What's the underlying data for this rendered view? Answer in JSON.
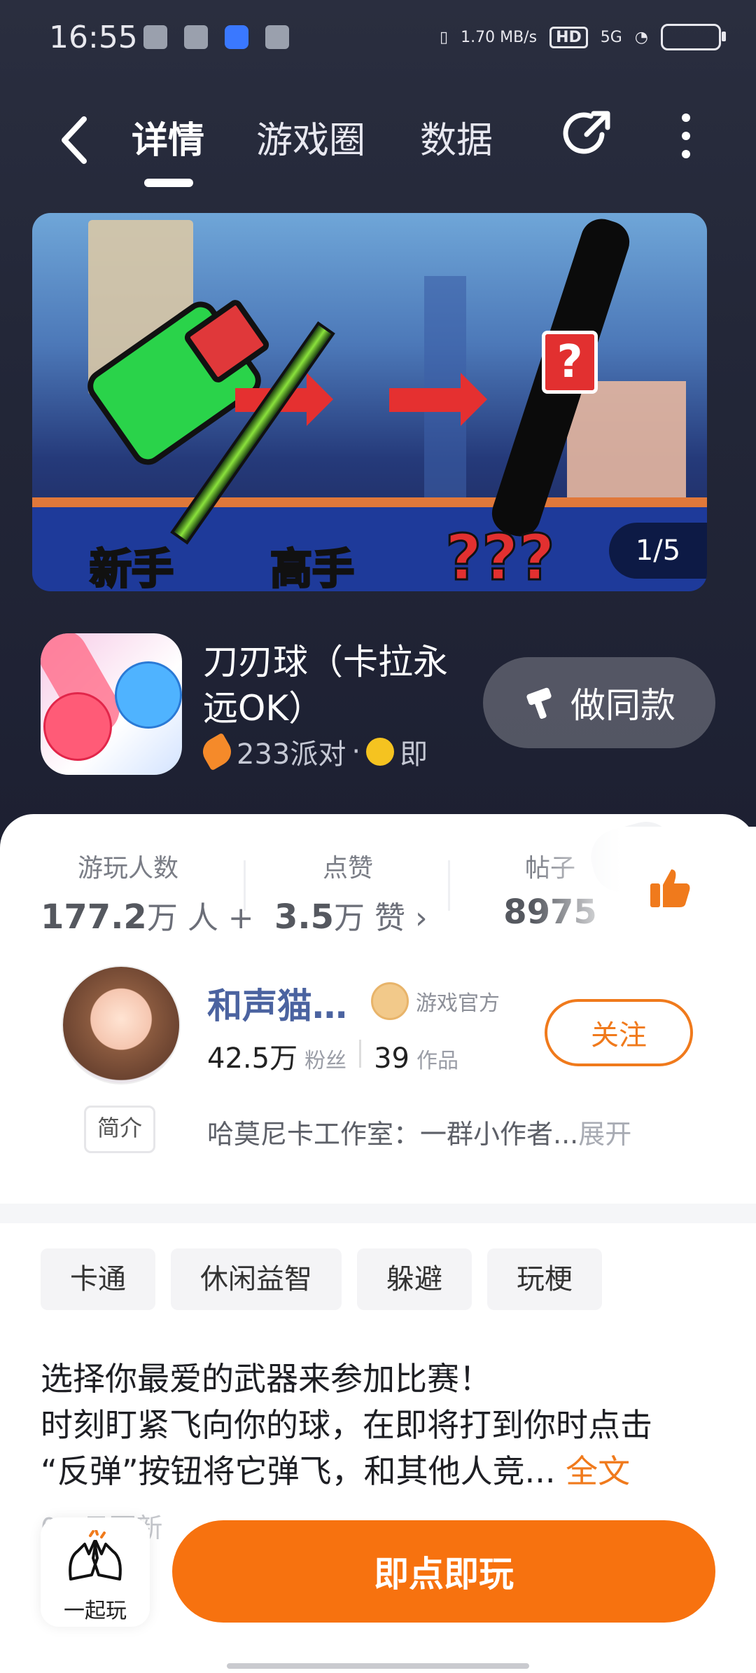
{
  "status_bar": {
    "time": "16:55",
    "net_speed": "1.70 MB/s",
    "hd": "HD",
    "signal": "5G"
  },
  "nav": {
    "tabs": [
      "详情",
      "游戏圈",
      "数据"
    ],
    "active_tab": "详情"
  },
  "banner": {
    "label_1": "新手",
    "label_2": "高手",
    "label_3": "???",
    "counter": "1/5"
  },
  "app": {
    "title": "刀刃球（卡拉永远OK）",
    "platform": "233派对",
    "dot": "·",
    "meta_tail": "即",
    "make_same_label": "做同款"
  },
  "stats": [
    {
      "label": "游玩人数",
      "value": "177.2",
      "unit": "万 人 +"
    },
    {
      "label": "点赞",
      "value": "3.5",
      "unit": "万 赞 ›"
    },
    {
      "label": "帖子",
      "value": "8975",
      "unit": ""
    }
  ],
  "author": {
    "name": "和声猫…",
    "badge": "游戏官方",
    "fans_count": "42.5万",
    "fans_label": "粉丝",
    "works_count": "39",
    "works_label": "作品",
    "follow_label": "关注",
    "intro_tag": "简介",
    "intro_text": "哈莫尼卡工作室：一群小作者...",
    "intro_expand": "展开"
  },
  "tags": [
    "卡通",
    "休闲益智",
    "躲避",
    "玩梗"
  ],
  "description": {
    "line1": "选择你最爱的武器来参加比赛！",
    "line2": "时刻盯紧飞向你的球，在即将打到你时点击",
    "line3": "“反弹”按钮将它弹飞，和其他人竞...",
    "more": "全文",
    "update": "0 . 日更新"
  },
  "bottom": {
    "play_together": "一起玩",
    "play_now": "即点即玩"
  },
  "colors": {
    "accent": "#f7720f",
    "link_blue": "#4b63a0"
  }
}
